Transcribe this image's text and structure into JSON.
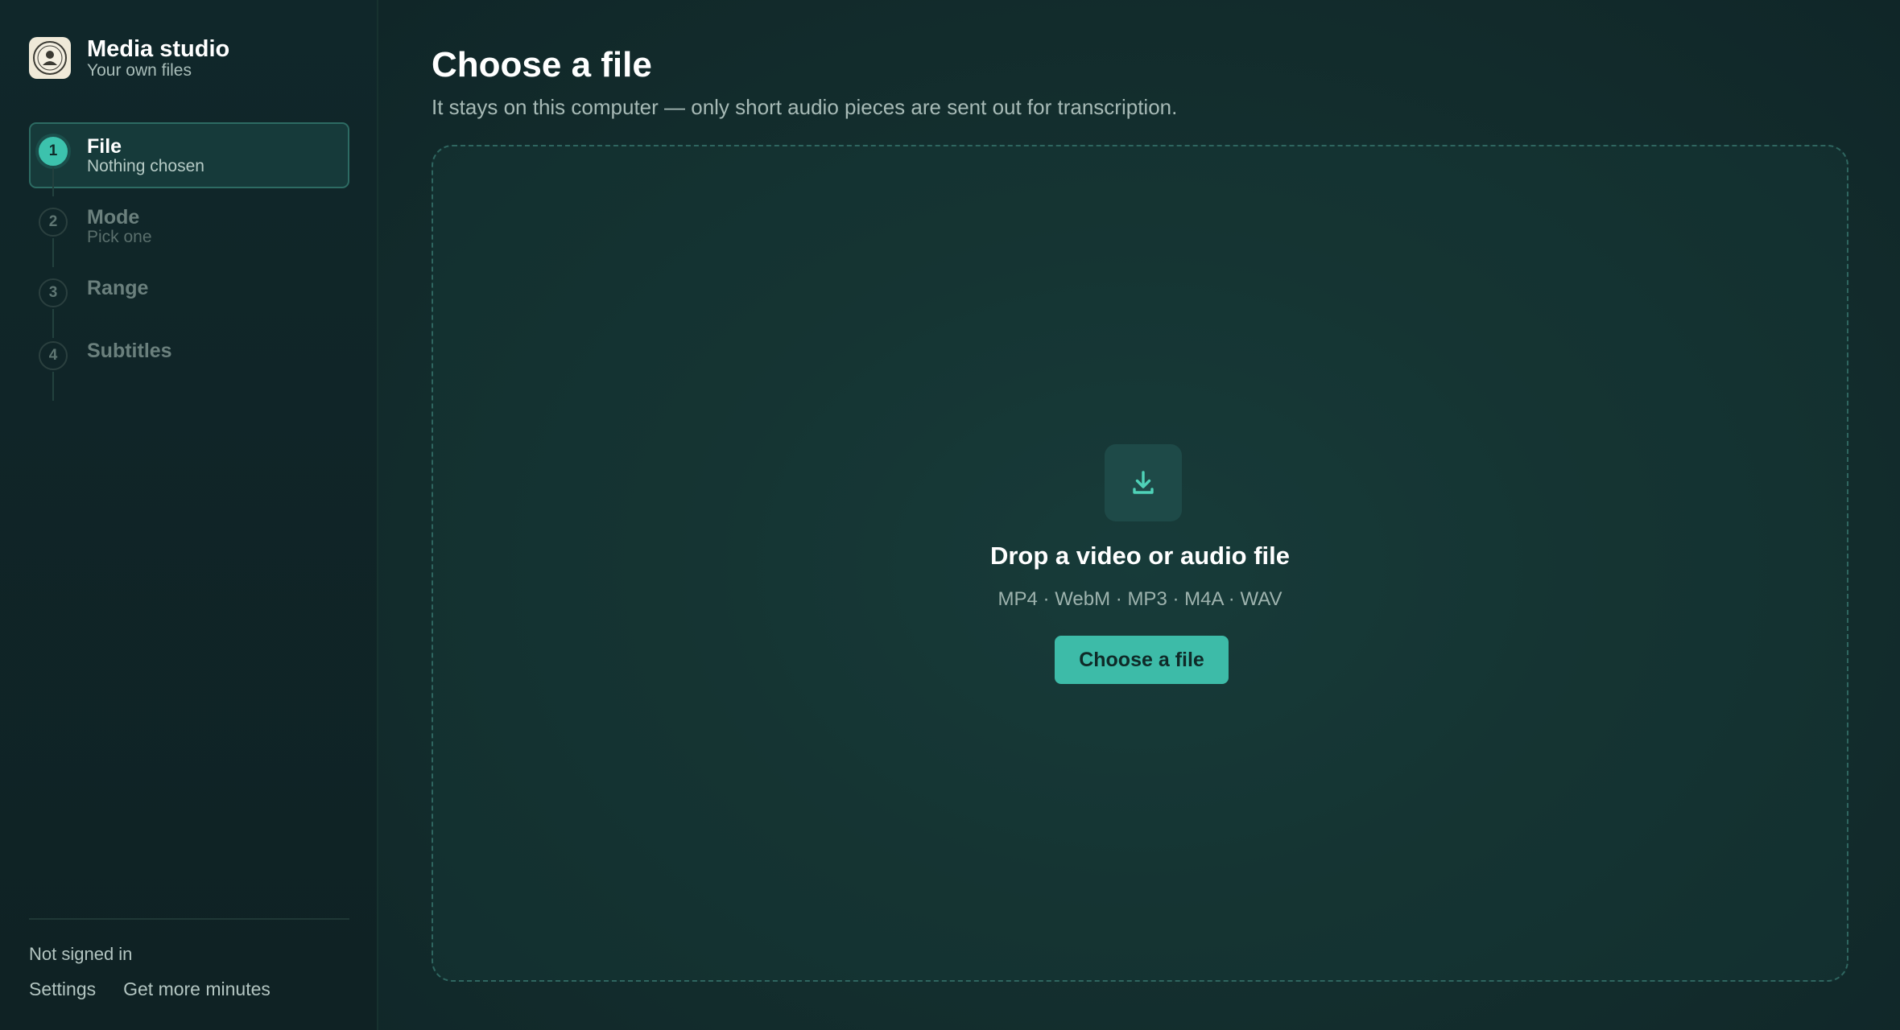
{
  "brand": {
    "title": "Media studio",
    "subtitle": "Your own files"
  },
  "steps": [
    {
      "number": "1",
      "title": "File",
      "subtitle": "Nothing chosen",
      "state": "active"
    },
    {
      "number": "2",
      "title": "Mode",
      "subtitle": "Pick one",
      "state": "inactive"
    },
    {
      "number": "3",
      "title": "Range",
      "subtitle": "",
      "state": "inactive"
    },
    {
      "number": "4",
      "title": "Subtitles",
      "subtitle": "",
      "state": "inactive"
    }
  ],
  "account": {
    "status": "Not signed in",
    "settings_label": "Settings",
    "more_minutes_label": "Get more minutes"
  },
  "main": {
    "title": "Choose a file",
    "subtitle": "It stays on this computer — only short audio pieces are sent out for transcription.",
    "dropzone": {
      "icon": "download-icon",
      "title": "Drop a video or audio file",
      "formats": "MP4 · WebM · MP3 · M4A · WAV",
      "button_label": "Choose a file"
    }
  },
  "colors": {
    "accent": "#3dbba8",
    "background": "#11262a",
    "sidebar": "#10272a"
  }
}
